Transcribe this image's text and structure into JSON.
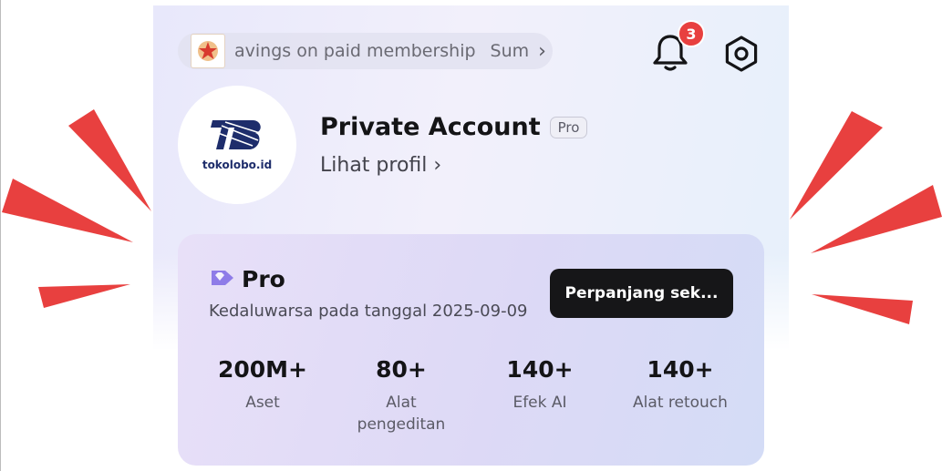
{
  "promo": {
    "text": "avings on paid membership",
    "suffix": "Sum",
    "chevron": "›",
    "thumb_icon": "promo-thumbnail"
  },
  "notifications": {
    "icon": "bell-icon",
    "count": "3"
  },
  "settings": {
    "icon": "gear-icon"
  },
  "profile": {
    "avatar_brand": "tokolobo.id",
    "name": "Private Account",
    "tier_tag": "Pro",
    "view_profile": "Lihat profil ›"
  },
  "membership": {
    "title": "Pro",
    "icon": "diamond-tag-icon",
    "expiry": "Kedaluwarsa pada tanggal 2025-09-09",
    "renew_label": "Perpanjang sek...",
    "stats": [
      {
        "value": "200M+",
        "label": "Aset"
      },
      {
        "value": "80+",
        "label": "Alat pengeditan"
      },
      {
        "value": "140+",
        "label": "Efek AI"
      },
      {
        "value": "140+",
        "label": "Alat retouch"
      }
    ]
  },
  "colors": {
    "badge": "#e8403f",
    "rays": "#e8403f",
    "button": "#161618",
    "pro_icon": "#8e7ce8"
  }
}
